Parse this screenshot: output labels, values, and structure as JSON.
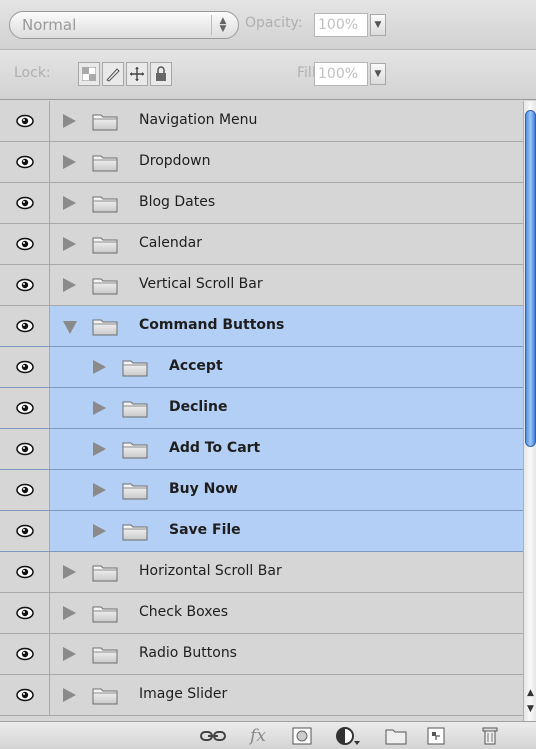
{
  "toolbar": {
    "blend_mode": "Normal",
    "opacity_label": "Opacity:",
    "opacity_value": "100%",
    "lock_label": "Lock:",
    "fill_label": "Fill:",
    "fill_value": "100%"
  },
  "layers": [
    {
      "name": "Navigation Menu",
      "expanded": false,
      "selected": false,
      "indent": 0
    },
    {
      "name": "Dropdown",
      "expanded": false,
      "selected": false,
      "indent": 0
    },
    {
      "name": "Blog Dates",
      "expanded": false,
      "selected": false,
      "indent": 0
    },
    {
      "name": "Calendar",
      "expanded": false,
      "selected": false,
      "indent": 0
    },
    {
      "name": "Vertical Scroll Bar",
      "expanded": false,
      "selected": false,
      "indent": 0
    },
    {
      "name": "Command Buttons",
      "expanded": true,
      "selected": true,
      "indent": 0
    },
    {
      "name": "Accept",
      "expanded": false,
      "selected": true,
      "indent": 1
    },
    {
      "name": "Decline",
      "expanded": false,
      "selected": true,
      "indent": 1
    },
    {
      "name": "Add To Cart",
      "expanded": false,
      "selected": true,
      "indent": 1
    },
    {
      "name": "Buy Now",
      "expanded": false,
      "selected": true,
      "indent": 1
    },
    {
      "name": "Save File",
      "expanded": false,
      "selected": true,
      "indent": 1
    },
    {
      "name": "Horizontal Scroll Bar",
      "expanded": false,
      "selected": false,
      "indent": 0
    },
    {
      "name": "Check Boxes",
      "expanded": false,
      "selected": false,
      "indent": 0
    },
    {
      "name": "Radio Buttons",
      "expanded": false,
      "selected": false,
      "indent": 0
    },
    {
      "name": "Image Slider",
      "expanded": false,
      "selected": false,
      "indent": 0
    }
  ],
  "bottom_icons": [
    "link-layers-icon",
    "fx-icon",
    "layer-mask-icon",
    "adjustment-layer-icon",
    "new-group-icon",
    "new-layer-icon",
    "trash-icon"
  ],
  "colors": {
    "selection": "#b4cff5",
    "panel": "#d6d6d6",
    "scroll_thumb": "#4f8fe6"
  }
}
